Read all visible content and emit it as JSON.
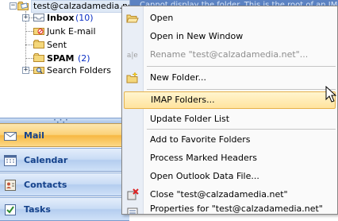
{
  "folder_tree": {
    "root": {
      "label": "test@calzadamedia.net",
      "expander": "−"
    },
    "items": [
      {
        "label": "Inbox",
        "count": "(10)",
        "bold": true,
        "expander": "+"
      },
      {
        "label": "Junk E-mail",
        "count": "",
        "bold": false
      },
      {
        "label": "Sent",
        "count": "",
        "bold": false
      },
      {
        "label": "SPAM",
        "count": "(2)",
        "bold": true
      },
      {
        "label": "Search Folders",
        "count": "",
        "bold": false,
        "expander": "+"
      }
    ]
  },
  "splitter_grip": "• • • • •",
  "nav_buttons": [
    {
      "label": "Mail",
      "icon": "mail-icon",
      "active": true
    },
    {
      "label": "Calendar",
      "icon": "calendar-icon",
      "active": false
    },
    {
      "label": "Contacts",
      "icon": "contacts-icon",
      "active": false
    },
    {
      "label": "Tasks",
      "icon": "tasks-icon",
      "active": false
    }
  ],
  "info_banner": "Cannot display the folder. This is the root of an IMAP",
  "context_menu": {
    "items": [
      {
        "label": "Open",
        "icon": "open-folder-icon",
        "disabled": false
      },
      {
        "label": "Open in New Window",
        "icon": "",
        "disabled": false
      },
      {
        "label": "Rename \"test@calzadamedia.net\"...",
        "icon": "rename-icon",
        "disabled": true
      },
      {
        "label": "New Folder...",
        "icon": "new-folder-icon",
        "disabled": false
      },
      {
        "label": "IMAP Folders...",
        "icon": "",
        "disabled": false,
        "highlight": true
      },
      {
        "label": "Update Folder List",
        "icon": "",
        "disabled": false
      },
      {
        "label": "Add to Favorite Folders",
        "icon": "",
        "disabled": false
      },
      {
        "label": "Process Marked Headers",
        "icon": "",
        "disabled": false
      },
      {
        "label": "Open Outlook Data File...",
        "icon": "",
        "disabled": false
      },
      {
        "label": "Close \"test@calzadamedia.net\"",
        "icon": "close-data-file-icon",
        "disabled": false
      },
      {
        "label": "Properties for \"test@calzadamedia.net\"",
        "icon": "properties-icon",
        "disabled": false
      }
    ]
  },
  "colors": {
    "highlight_border": "#e6b24c",
    "active_nav": "#f7b843",
    "count_blue": "#0a2fc4"
  }
}
